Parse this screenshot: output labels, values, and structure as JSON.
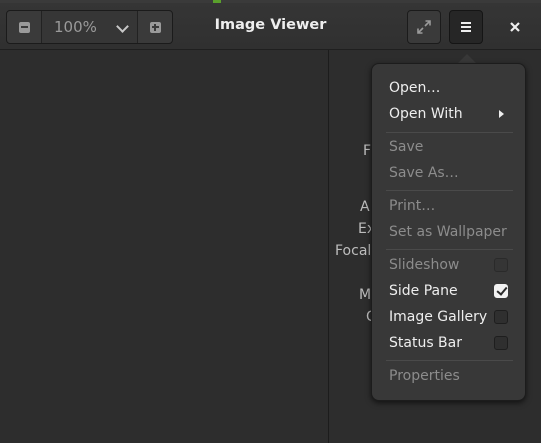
{
  "window": {
    "title": "Image Viewer"
  },
  "zoom": {
    "value": "100%"
  },
  "sidepane": {
    "labels": [
      "F",
      "A",
      "Ex",
      "Focal",
      "M",
      "C"
    ]
  },
  "menu": {
    "items": [
      {
        "label": "Open…",
        "enabled": true
      },
      {
        "label": "Open With",
        "enabled": true,
        "submenu": true
      },
      {
        "label": "Save",
        "enabled": false
      },
      {
        "label": "Save As…",
        "enabled": false
      },
      {
        "label": "Print…",
        "enabled": false
      },
      {
        "label": "Set as Wallpaper",
        "enabled": false
      },
      {
        "label": "Slideshow",
        "enabled": false,
        "checkbox": false
      },
      {
        "label": "Side Pane",
        "enabled": true,
        "checkbox": true
      },
      {
        "label": "Image Gallery",
        "enabled": true,
        "checkbox": false
      },
      {
        "label": "Status Bar",
        "enabled": true,
        "checkbox": false
      },
      {
        "label": "Properties",
        "enabled": false
      }
    ]
  },
  "colors": {
    "background": "#2d2d2d",
    "headerbar": "#333333",
    "popover": "#383838",
    "disabled_text": "#8c8c8c"
  }
}
